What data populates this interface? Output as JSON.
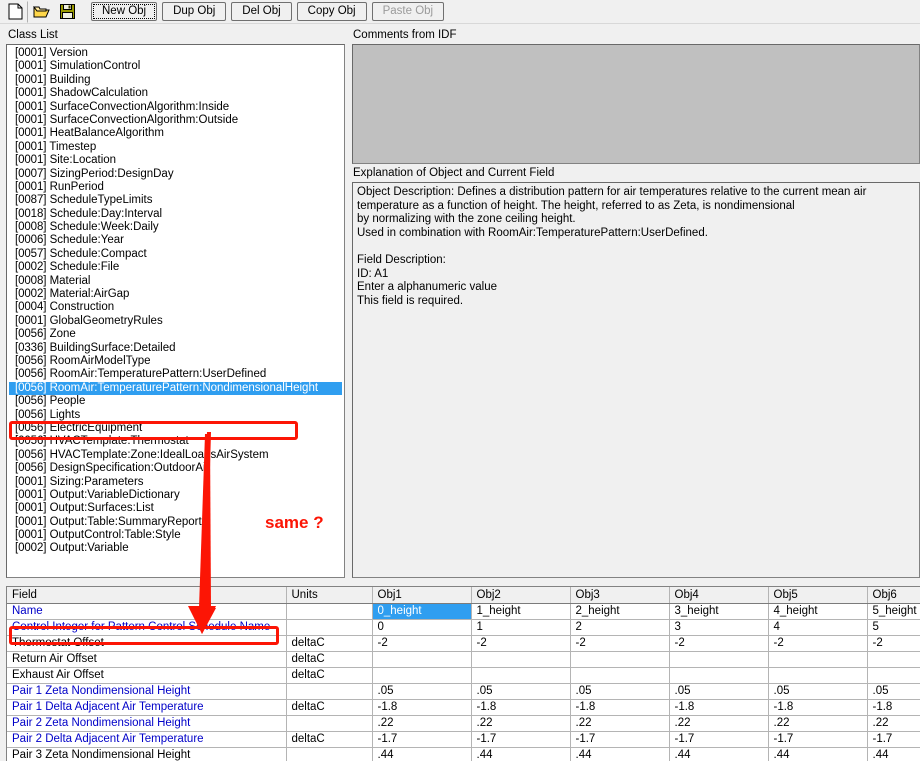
{
  "toolbar": {
    "icons": [
      {
        "name": "new-file-icon",
        "label": "New File"
      },
      {
        "name": "open-folder-icon",
        "label": "Open File"
      },
      {
        "name": "save-disk-icon",
        "label": "Save File"
      }
    ],
    "buttons": [
      {
        "name": "new-obj-button",
        "label": "New Obj",
        "disabled": false,
        "focused": true
      },
      {
        "name": "dup-obj-button",
        "label": "Dup Obj",
        "disabled": false,
        "focused": false
      },
      {
        "name": "del-obj-button",
        "label": "Del Obj",
        "disabled": false,
        "focused": false
      },
      {
        "name": "copy-obj-button",
        "label": "Copy Obj",
        "disabled": false,
        "focused": false
      },
      {
        "name": "paste-obj-button",
        "label": "Paste Obj",
        "disabled": true,
        "focused": false
      }
    ]
  },
  "labels": {
    "class_list": "Class List",
    "comments": "Comments from IDF",
    "explanation": "Explanation of Object and Current Field"
  },
  "class_list": {
    "selected_index": 22,
    "items": [
      {
        "count": "[0001]",
        "name": "Version"
      },
      {
        "count": "[0001]",
        "name": "SimulationControl"
      },
      {
        "count": "[0001]",
        "name": "Building"
      },
      {
        "count": "[0001]",
        "name": "ShadowCalculation"
      },
      {
        "count": "[0001]",
        "name": "SurfaceConvectionAlgorithm:Inside"
      },
      {
        "count": "[0001]",
        "name": "SurfaceConvectionAlgorithm:Outside"
      },
      {
        "count": "[0001]",
        "name": "HeatBalanceAlgorithm"
      },
      {
        "count": "[0001]",
        "name": "Timestep"
      },
      {
        "count": "[0001]",
        "name": "Site:Location"
      },
      {
        "count": "[0007]",
        "name": "SizingPeriod:DesignDay"
      },
      {
        "count": "[0001]",
        "name": "RunPeriod"
      },
      {
        "count": "[0087]",
        "name": "ScheduleTypeLimits"
      },
      {
        "count": "[0018]",
        "name": "Schedule:Day:Interval"
      },
      {
        "count": "[0008]",
        "name": "Schedule:Week:Daily"
      },
      {
        "count": "[0006]",
        "name": "Schedule:Year"
      },
      {
        "count": "[0057]",
        "name": "Schedule:Compact"
      },
      {
        "count": "[0002]",
        "name": "Schedule:File"
      },
      {
        "count": "[0008]",
        "name": "Material"
      },
      {
        "count": "[0002]",
        "name": "Material:AirGap"
      },
      {
        "count": "[0004]",
        "name": "Construction"
      },
      {
        "count": "[0001]",
        "name": "GlobalGeometryRules"
      },
      {
        "count": "[0056]",
        "name": "Zone"
      },
      {
        "count": "[0336]",
        "name": "BuildingSurface:Detailed"
      },
      {
        "count": "[0056]",
        "name": "RoomAirModelType"
      },
      {
        "count": "[0056]",
        "name": "RoomAir:TemperaturePattern:UserDefined"
      },
      {
        "count": "[0056]",
        "name": "RoomAir:TemperaturePattern:NondimensionalHeight"
      },
      {
        "count": "[0056]",
        "name": "People"
      },
      {
        "count": "[0056]",
        "name": "Lights"
      },
      {
        "count": "[0056]",
        "name": "ElectricEquipment"
      },
      {
        "count": "[0056]",
        "name": "HVACTemplate:Thermostat"
      },
      {
        "count": "[0056]",
        "name": "HVACTemplate:Zone:IdealLoadsAirSystem"
      },
      {
        "count": "[0056]",
        "name": "DesignSpecification:OutdoorAir"
      },
      {
        "count": "[0001]",
        "name": "Sizing:Parameters"
      },
      {
        "count": "[0001]",
        "name": "Output:VariableDictionary"
      },
      {
        "count": "[0001]",
        "name": "Output:Surfaces:List"
      },
      {
        "count": "[0001]",
        "name": "Output:Table:SummaryReports"
      },
      {
        "count": "[0001]",
        "name": "OutputControl:Table:Style"
      },
      {
        "count": "[0002]",
        "name": "Output:Variable"
      }
    ],
    "selected_item": "RoomAir:TemperaturePattern:NondimensionalHeight"
  },
  "comments": {
    "value": ""
  },
  "explanation": {
    "text": "Object Description: Defines a distribution pattern for air temperatures relative to the current mean air\ntemperature as a function of height. The height, referred to as Zeta, is nondimensional\nby normalizing with the zone ceiling height.\nUsed in combination with RoomAir:TemperaturePattern:UserDefined.\n\nField Description:\nID: A1\nEnter a alphanumeric value\nThis field is required."
  },
  "grid": {
    "headers": [
      "Field",
      "Units",
      "Obj1",
      "Obj2",
      "Obj3",
      "Obj4",
      "Obj5",
      "Obj6"
    ],
    "selected_cell": {
      "row": 0,
      "col": 0
    },
    "rows": [
      {
        "field": "Name",
        "field_blue": true,
        "units": "",
        "values": [
          "0_height",
          "1_height",
          "2_height",
          "3_height",
          "4_height",
          "5_height"
        ]
      },
      {
        "field": "Control Integer for Pattern Control Schedule Name",
        "field_blue": true,
        "units": "",
        "values": [
          "0",
          "1",
          "2",
          "3",
          "4",
          "5"
        ]
      },
      {
        "field": "Thermostat Offset",
        "field_blue": false,
        "units": "deltaC",
        "values": [
          "-2",
          "-2",
          "-2",
          "-2",
          "-2",
          "-2"
        ]
      },
      {
        "field": "Return Air Offset",
        "field_blue": false,
        "units": "deltaC",
        "values": [
          "",
          "",
          "",
          "",
          "",
          ""
        ]
      },
      {
        "field": "Exhaust Air Offset",
        "field_blue": false,
        "units": "deltaC",
        "values": [
          "",
          "",
          "",
          "",
          "",
          ""
        ]
      },
      {
        "field": "Pair 1 Zeta Nondimensional Height",
        "field_blue": true,
        "units": "",
        "values": [
          ".05",
          ".05",
          ".05",
          ".05",
          ".05",
          ".05"
        ]
      },
      {
        "field": "Pair 1 Delta Adjacent Air Temperature",
        "field_blue": true,
        "units": "deltaC",
        "values": [
          "-1.8",
          "-1.8",
          "-1.8",
          "-1.8",
          "-1.8",
          "-1.8"
        ]
      },
      {
        "field": "Pair 2 Zeta Nondimensional Height",
        "field_blue": true,
        "units": "",
        "values": [
          ".22",
          ".22",
          ".22",
          ".22",
          ".22",
          ".22"
        ]
      },
      {
        "field": "Pair 2 Delta Adjacent Air Temperature",
        "field_blue": true,
        "units": "deltaC",
        "values": [
          "-1.7",
          "-1.7",
          "-1.7",
          "-1.7",
          "-1.7",
          "-1.7"
        ]
      },
      {
        "field": "Pair 3 Zeta Nondimensional Height",
        "field_blue": false,
        "units": "",
        "values": [
          ".44",
          ".44",
          ".44",
          ".44",
          ".44",
          ".44"
        ]
      }
    ]
  },
  "annotations": {
    "color": "#fc1505",
    "note_label": "same ?",
    "highlighted_class_item": "HVACTemplate:Thermostat",
    "highlighted_grid_field": "Thermostat Offset"
  }
}
